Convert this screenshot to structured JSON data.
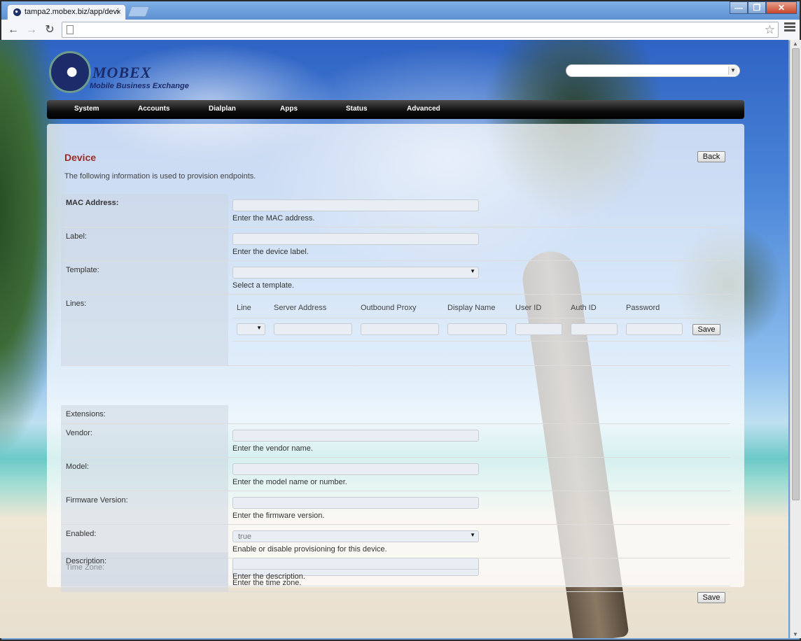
{
  "browser": {
    "tab_title": "tampa2.mobex.biz/app/devi",
    "tab_close": "×",
    "url": "",
    "window_buttons": [
      "—",
      "❐",
      "✕"
    ]
  },
  "header": {
    "logo_title": "MOBEX",
    "logo_subtitle": "Mobile Business Exchange",
    "domain_select_value": ""
  },
  "nav": {
    "items": [
      "System",
      "Accounts",
      "Dialplan",
      "Apps",
      "Status",
      "Advanced"
    ]
  },
  "page": {
    "title": "Device",
    "intro": "The following information is used to provision endpoints.",
    "back_label": "Back",
    "save_label": "Save"
  },
  "form": {
    "mac": {
      "label": "MAC Address:",
      "hint": "Enter the MAC address.",
      "value": ""
    },
    "label": {
      "label": "Label:",
      "hint": "Enter the device label.",
      "value": ""
    },
    "template": {
      "label": "Template:",
      "hint": "Select a template.",
      "value": ""
    },
    "lines": {
      "label": "Lines:",
      "columns": [
        "Line",
        "Server Address",
        "Outbound Proxy",
        "Display Name",
        "User ID",
        "Auth ID",
        "Password"
      ],
      "save_label": "Save"
    },
    "extensions": {
      "label": "Extensions:"
    },
    "vendor": {
      "label": "Vendor:",
      "hint": "Enter the vendor name.",
      "value": ""
    },
    "model": {
      "label": "Model:",
      "hint": "Enter the model name or number.",
      "value": ""
    },
    "firmware": {
      "label": "Firmware Version:",
      "hint": "Enter the firmware version.",
      "value": ""
    },
    "enabled": {
      "label": "Enabled:",
      "hint": "Enable or disable provisioning for this device.",
      "value": "true"
    },
    "timezone": {
      "label": "Time Zone:",
      "hint": "Enter the time zone.",
      "value": ""
    },
    "description": {
      "label": "Description:",
      "hint": "Enter the description.",
      "value": ""
    }
  }
}
